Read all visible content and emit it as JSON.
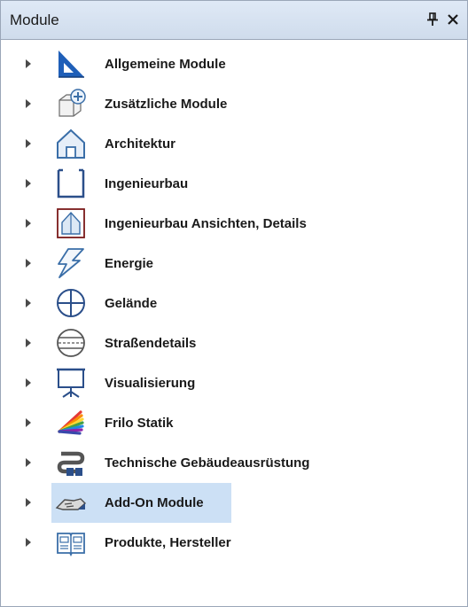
{
  "panel": {
    "title": "Module",
    "pin_glyph": "pin-icon",
    "close_glyph": "close-icon"
  },
  "colors": {
    "titlebar": "#d6e2f1",
    "selection": "#cce0f5",
    "text": "#1a1a1a",
    "accent_blue": "#1f5fb8"
  },
  "tree": {
    "items": [
      {
        "label": "Allgemeine Module",
        "icon": "set-square-icon",
        "selected": false
      },
      {
        "label": "Zusätzliche Module",
        "icon": "cube-plus-icon",
        "selected": false
      },
      {
        "label": "Architektur",
        "icon": "house-icon",
        "selected": false
      },
      {
        "label": "Ingenieurbau",
        "icon": "bracket-frame-icon",
        "selected": false
      },
      {
        "label": "Ingenieurbau Ansichten, Details",
        "icon": "section-view-icon",
        "selected": false
      },
      {
        "label": "Energie",
        "icon": "lightning-icon",
        "selected": false
      },
      {
        "label": "Gelände",
        "icon": "crosshair-circle-icon",
        "selected": false
      },
      {
        "label": "Straßendetails",
        "icon": "road-section-icon",
        "selected": false
      },
      {
        "label": "Visualisierung",
        "icon": "presentation-board-icon",
        "selected": false
      },
      {
        "label": "Frilo Statik",
        "icon": "color-fan-icon",
        "selected": false
      },
      {
        "label": "Technische Gebäudeausrüstung",
        "icon": "pipe-fitting-icon",
        "selected": false
      },
      {
        "label": "Add-On Module",
        "icon": "handshake-icon",
        "selected": true
      },
      {
        "label": "Produkte, Hersteller",
        "icon": "catalog-book-icon",
        "selected": false
      }
    ]
  }
}
